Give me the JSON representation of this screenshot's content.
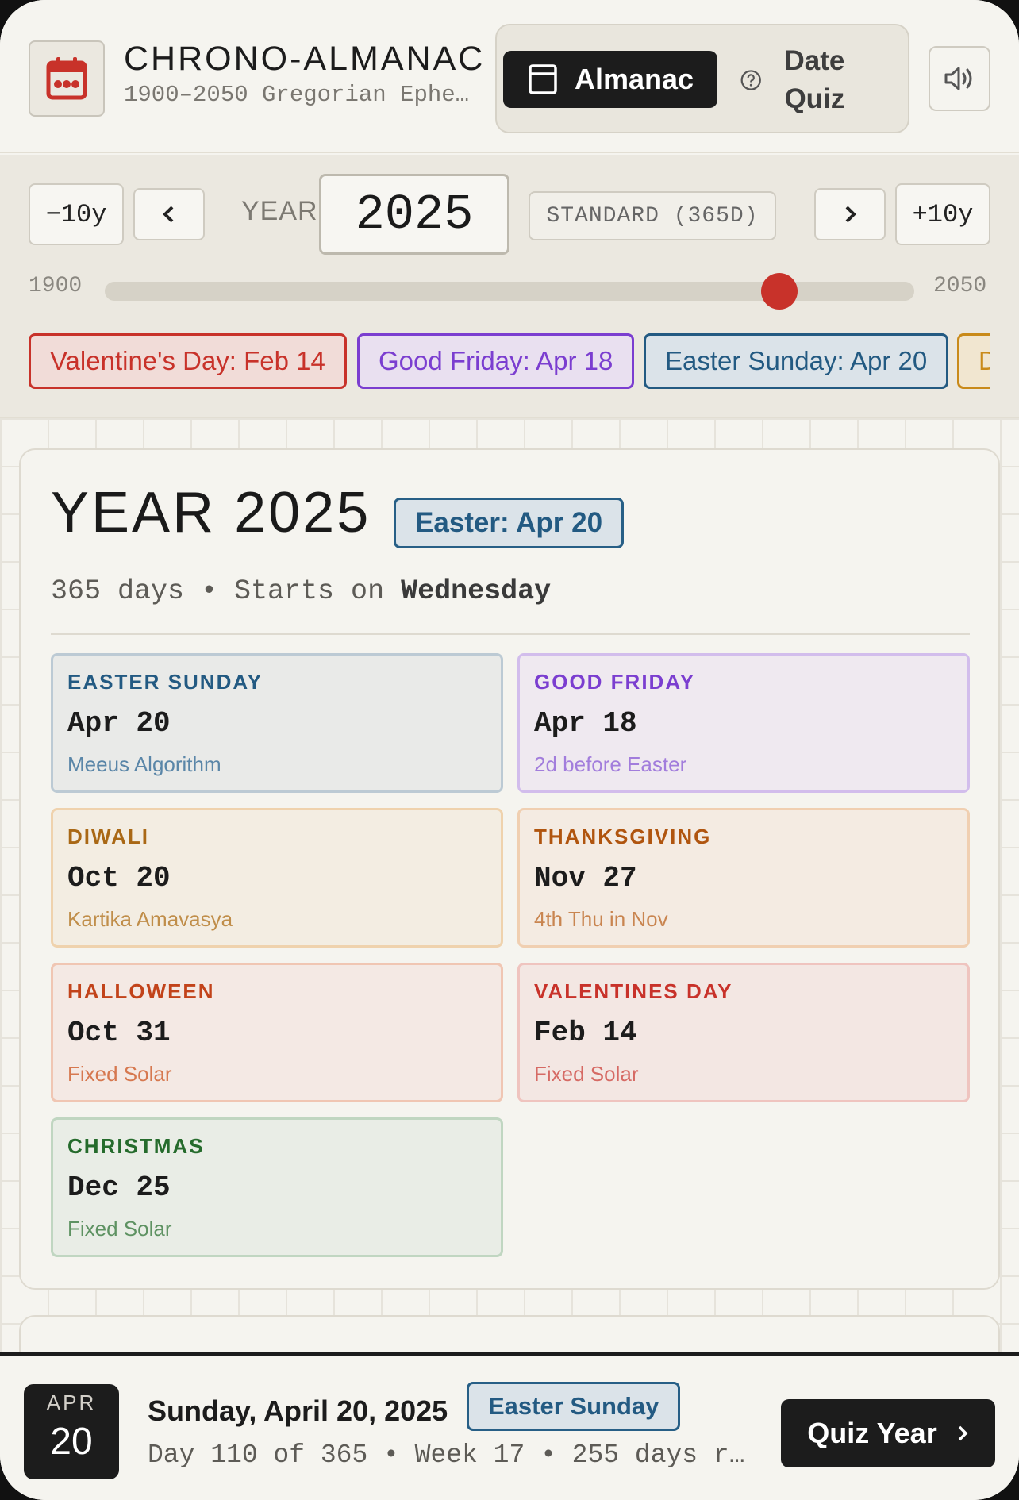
{
  "header": {
    "app_title": "CHRONO-ALMANAC",
    "app_subtitle": "1900–2050 Gregorian Ephe…",
    "tabs": [
      {
        "label": "Almanac",
        "active": true
      },
      {
        "label": "Date Quiz",
        "active": false
      }
    ]
  },
  "controls": {
    "minus10_label": "−10y",
    "plus10_label": "+10y",
    "year_label": "YEAR",
    "year_value": "2025",
    "year_type": "STANDARD (365D)",
    "range_min": "1900",
    "range_max": "2050",
    "slider_value": 2025
  },
  "chips": [
    {
      "label": "Valentine's Day: Feb 14",
      "color": "#c8322a",
      "bg": "#f1dcd8"
    },
    {
      "label": "Good Friday: Apr 18",
      "color": "#7b3ed0",
      "bg": "#e9e0f0"
    },
    {
      "label": "Easter Sunday: Apr 20",
      "color": "#235a82",
      "bg": "#dbe3e9"
    },
    {
      "label": "D",
      "color": "#c98a1a",
      "bg": "#f1e6d0"
    }
  ],
  "year_card": {
    "heading": "YEAR 2025",
    "easter_badge": "Easter: Apr 20",
    "days_text": "365 days • Starts on ",
    "start_day": "Wednesday"
  },
  "holidays": [
    {
      "name": "EASTER SUNDAY",
      "date": "Apr 20",
      "note": "Meeus Algorithm",
      "color": "#235a82",
      "note_color": "#5a86a8",
      "bg": "#e9eae8",
      "border": "#bccad4"
    },
    {
      "name": "GOOD FRIDAY",
      "date": "Apr 18",
      "note": "2d before Easter",
      "color": "#7b3ed0",
      "note_color": "#a27ddc",
      "bg": "#efe9f0",
      "border": "#d2bdec"
    },
    {
      "name": "DIWALI",
      "date": "Oct 20",
      "note": "Kartika Amavasya",
      "color": "#a96815",
      "note_color": "#c08e4a",
      "bg": "#f3ede2",
      "border": "#efd2ad"
    },
    {
      "name": "THANKSGIVING",
      "date": "Nov 27",
      "note": "4th Thu in Nov",
      "color": "#b0550f",
      "note_color": "#c98550",
      "bg": "#f4ebe2",
      "border": "#f0cfb1"
    },
    {
      "name": "HALLOWEEN",
      "date": "Oct 31",
      "note": "Fixed Solar",
      "color": "#c2431a",
      "note_color": "#d6784f",
      "bg": "#f4e9e4",
      "border": "#f0c6b3"
    },
    {
      "name": "VALENTINES DAY",
      "date": "Feb 14",
      "note": "Fixed Solar",
      "color": "#c8322a",
      "note_color": "#d66a64",
      "bg": "#f3e7e3",
      "border": "#efc4bf"
    },
    {
      "name": "CHRISTMAS",
      "date": "Dec 25",
      "note": "Fixed Solar",
      "color": "#256b2c",
      "note_color": "#5e9262",
      "bg": "#e9ede6",
      "border": "#c0d6c1"
    }
  ],
  "bottom": {
    "month": "APR",
    "day": "20",
    "full_date": "Sunday, April 20, 2025",
    "badge": "Easter Sunday",
    "day_info": "Day 110 of 365 • Week 17 • 255 days r…",
    "quiz_button": "Quiz Year"
  }
}
